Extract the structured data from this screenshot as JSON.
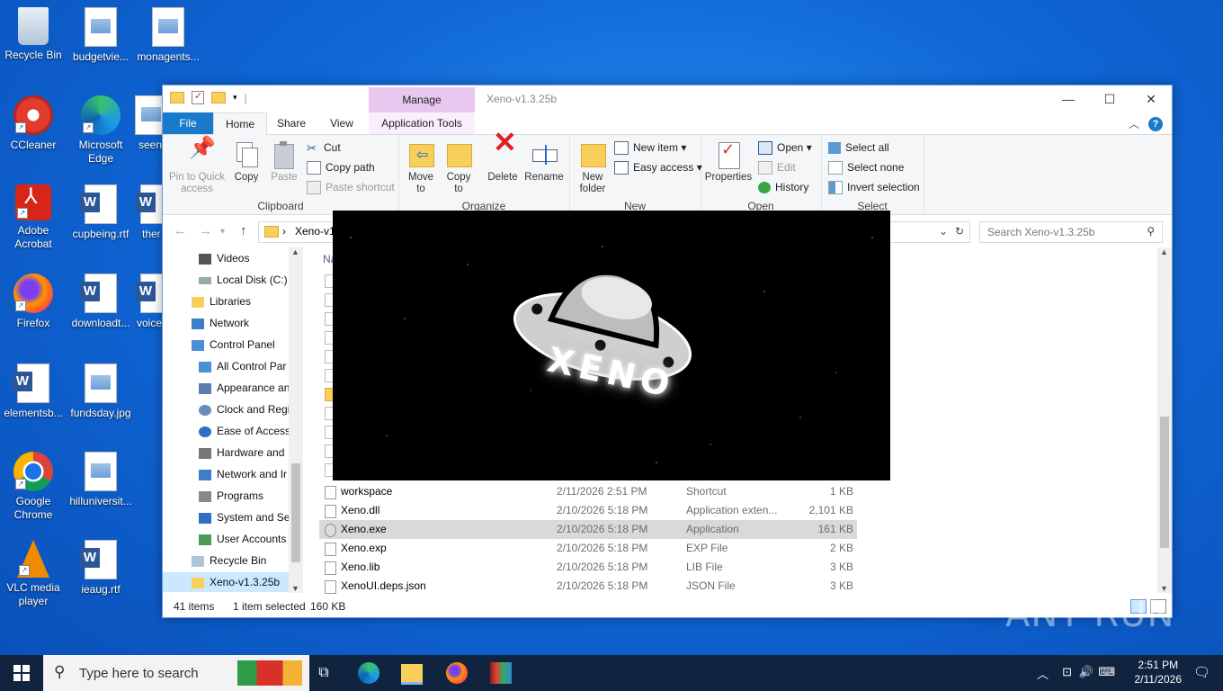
{
  "desktop": {
    "icons": [
      {
        "label": "Recycle Bin"
      },
      {
        "label": "budgetvie..."
      },
      {
        "label": "monagents..."
      },
      {
        "label": "CCleaner"
      },
      {
        "label": "Microsoft Edge"
      },
      {
        "label": "seen"
      },
      {
        "label": "Adobe Acrobat"
      },
      {
        "label": "cupbeing.rtf"
      },
      {
        "label": "ther"
      },
      {
        "label": "Firefox"
      },
      {
        "label": "downloadt..."
      },
      {
        "label": "voice"
      },
      {
        "label": "elementsb..."
      },
      {
        "label": "fundsday.jpg"
      },
      {
        "label": "Google Chrome"
      },
      {
        "label": "hilluniversit..."
      },
      {
        "label": "VLC media player"
      },
      {
        "label": "ieaug.rtf"
      }
    ]
  },
  "window": {
    "title": "Xeno-v1.3.25b",
    "manage_label": "Manage",
    "tabs": {
      "file": "File",
      "home": "Home",
      "share": "Share",
      "view": "View",
      "app_tools": "Application Tools"
    },
    "ribbon": {
      "clipboard": {
        "label": "Clipboard",
        "pin": "Pin to Quick access",
        "copy": "Copy",
        "paste": "Paste",
        "cut": "Cut",
        "copy_path": "Copy path",
        "paste_shortcut": "Paste shortcut"
      },
      "organize": {
        "label": "Organize",
        "move_to": "Move to",
        "copy_to": "Copy to",
        "delete": "Delete",
        "rename": "Rename"
      },
      "new": {
        "label": "New",
        "new_folder": "New folder",
        "new_item": "New item",
        "easy_access": "Easy access"
      },
      "open": {
        "label": "Open",
        "properties": "Properties",
        "open": "Open",
        "edit": "Edit",
        "history": "History"
      },
      "select": {
        "label": "Select",
        "select_all": "Select all",
        "select_none": "Select none",
        "invert": "Invert selection"
      }
    },
    "address": {
      "path": "Xeno-v1"
    },
    "search": {
      "placeholder": "Search Xeno-v1.3.25b"
    },
    "nav_items": [
      {
        "label": "Videos"
      },
      {
        "label": "Local Disk (C:)"
      },
      {
        "label": "Libraries"
      },
      {
        "label": "Network"
      },
      {
        "label": "Control Panel"
      },
      {
        "label": "All Control Par"
      },
      {
        "label": "Appearance an"
      },
      {
        "label": "Clock and Regi"
      },
      {
        "label": "Ease of Access"
      },
      {
        "label": "Hardware and"
      },
      {
        "label": "Network and Ir"
      },
      {
        "label": "Programs"
      },
      {
        "label": "System and Se"
      },
      {
        "label": "User Accounts"
      },
      {
        "label": "Recycle Bin"
      },
      {
        "label": "Xeno-v1.3.25b"
      }
    ],
    "column_header": "Na",
    "files": [
      {
        "name": "workspace",
        "date": "2/11/2026 2:51 PM",
        "type": "Shortcut",
        "size": "1 KB"
      },
      {
        "name": "Xeno.dll",
        "date": "2/10/2026 5:18 PM",
        "type": "Application exten...",
        "size": "2,101 KB"
      },
      {
        "name": "Xeno.exe",
        "date": "2/10/2026 5:18 PM",
        "type": "Application",
        "size": "161 KB"
      },
      {
        "name": "Xeno.exp",
        "date": "2/10/2026 5:18 PM",
        "type": "EXP File",
        "size": "2 KB"
      },
      {
        "name": "Xeno.lib",
        "date": "2/10/2026 5:18 PM",
        "type": "LIB File",
        "size": "3 KB"
      },
      {
        "name": "XenoUI.deps.json",
        "date": "2/10/2026 5:18 PM",
        "type": "JSON File",
        "size": "3 KB"
      }
    ],
    "status": {
      "items": "41 items",
      "selected": "1 item selected",
      "size": "160 KB"
    }
  },
  "splash": {
    "text": "XENO"
  },
  "taskbar": {
    "search_placeholder": "Type here to search",
    "time": "2:51 PM",
    "date": "2/11/2026"
  },
  "watermark": "ANY RUN"
}
